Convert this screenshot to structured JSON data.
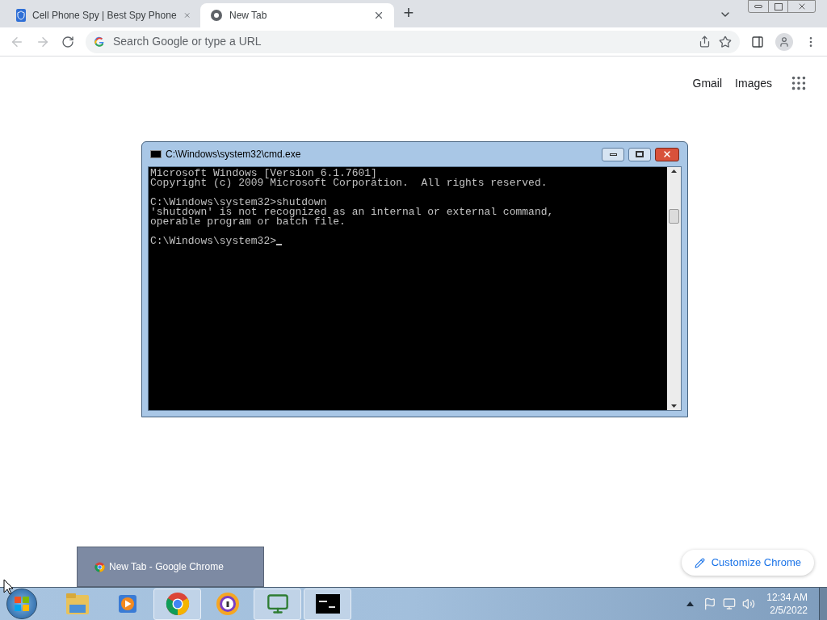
{
  "browser": {
    "tabs": [
      {
        "title": "Cell Phone Spy | Best Spy Phone",
        "kind": "shield",
        "selected": false
      },
      {
        "title": "New Tab",
        "kind": "chrome",
        "selected": true
      }
    ],
    "new_tab": "+",
    "address": {
      "placeholder": "Search Google or type a URL"
    },
    "links": [
      "Gmail",
      "Images"
    ],
    "customize": "Customize Chrome"
  },
  "console": {
    "title": "C:\\Windows\\system32\\cmd.exe",
    "blocks": [
      [
        "Microsoft Windows [Version 6.1.7601]",
        "Copyright (c) 2009 Microsoft Corporation.  All rights reserved."
      ],
      [
        "C:\\Windows\\system32>shutdown",
        "'shutdown' is not recognized as an internal or external command,",
        "operable program or batch file."
      ],
      [
        "C:\\Windows\\system32>"
      ]
    ]
  },
  "taskbar": {
    "tooltip": "New Tab - Google Chrome",
    "apps": [
      {
        "kind": "explorer",
        "running": false
      },
      {
        "kind": "media",
        "running": false
      },
      {
        "kind": "chrome",
        "running": true
      },
      {
        "kind": "secure",
        "running": false
      },
      {
        "kind": "monitor",
        "running": true
      },
      {
        "kind": "console",
        "running": true
      }
    ],
    "clock": {
      "time": "12:34 AM",
      "date": "2/5/2022"
    }
  }
}
